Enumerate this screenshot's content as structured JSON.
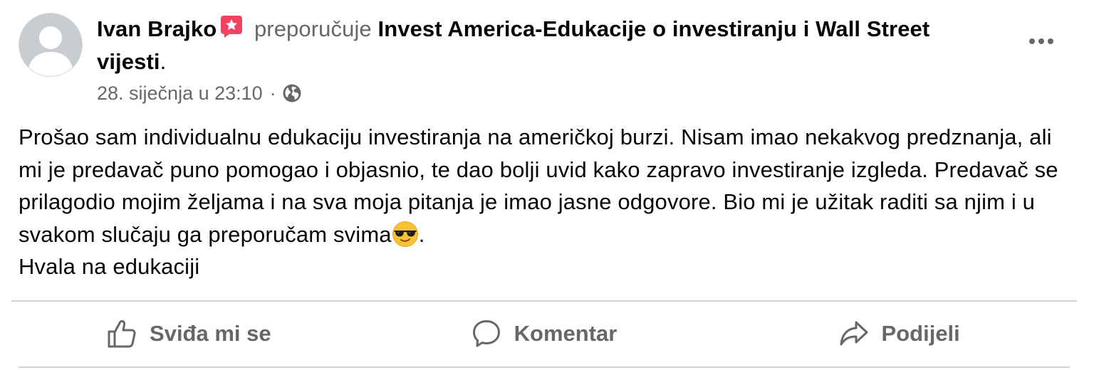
{
  "post": {
    "author": "Ivan Brajko",
    "recommends_text": "preporučuje",
    "page_name": "Invest America-Edukacije o investiranju i Wall Street vijesti",
    "period": ".",
    "timestamp": "28. siječnja u 23:10",
    "separator": "·",
    "privacy_icon": "globe-icon",
    "recommend_icon": "recommend-star-icon",
    "body": {
      "paragraph_1": "Prošao sam individualnu edukaciju investiranja na američkoj burzi. Nisam imao nekakvog predznanja, ali mi je predavač puno pomogao i objasnio, te dao bolji uvid kako zapravo investiranje izgleda. Predavač se prilagodio mojim željama i na sva moja pitanja je imao jasne odgovore. Bio mi je užitak raditi sa njim i u svakom slučaju ga preporučam svima",
      "emoji": "smiling-face-with-sunglasses",
      "after_emoji": ".",
      "paragraph_2": "Hvala na edukaciji"
    }
  },
  "actions": {
    "like": {
      "label": "Sviđa mi se",
      "icon": "thumbs-up-icon"
    },
    "comment": {
      "label": "Komentar",
      "icon": "comment-icon"
    },
    "share": {
      "label": "Podijeli",
      "icon": "share-icon"
    }
  },
  "colors": {
    "text": "#050505",
    "secondary_text": "#65676b",
    "recommend_red": "#f3425f",
    "divider": "#ced0d4"
  }
}
